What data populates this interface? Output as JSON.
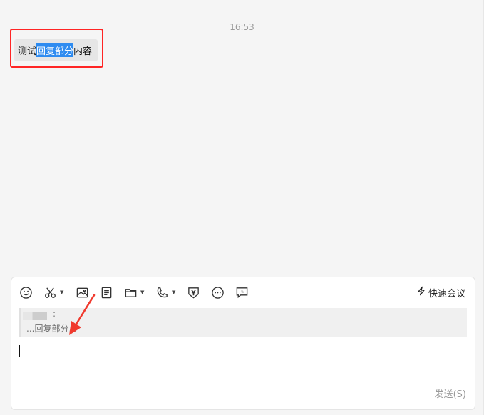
{
  "chat": {
    "timestamp": "16:53",
    "message": {
      "before": "测试",
      "selected": "回复部分",
      "after": "内容"
    }
  },
  "composer": {
    "toolbar": {
      "icons": [
        "emoji-icon",
        "scissors-icon",
        "image-icon",
        "document-icon",
        "folder-icon",
        "phone-icon",
        "yen-shield-icon",
        "more-icon",
        "feedback-icon"
      ],
      "quick_meeting_label": "快速会议"
    },
    "quote": {
      "separator": ":",
      "text": "...回复部分..."
    },
    "send_label": "发送(S)"
  },
  "colors": {
    "selection": "#2e8bf0",
    "highlight_border": "#ff2525",
    "annotation_arrow": "#f03a2e"
  }
}
